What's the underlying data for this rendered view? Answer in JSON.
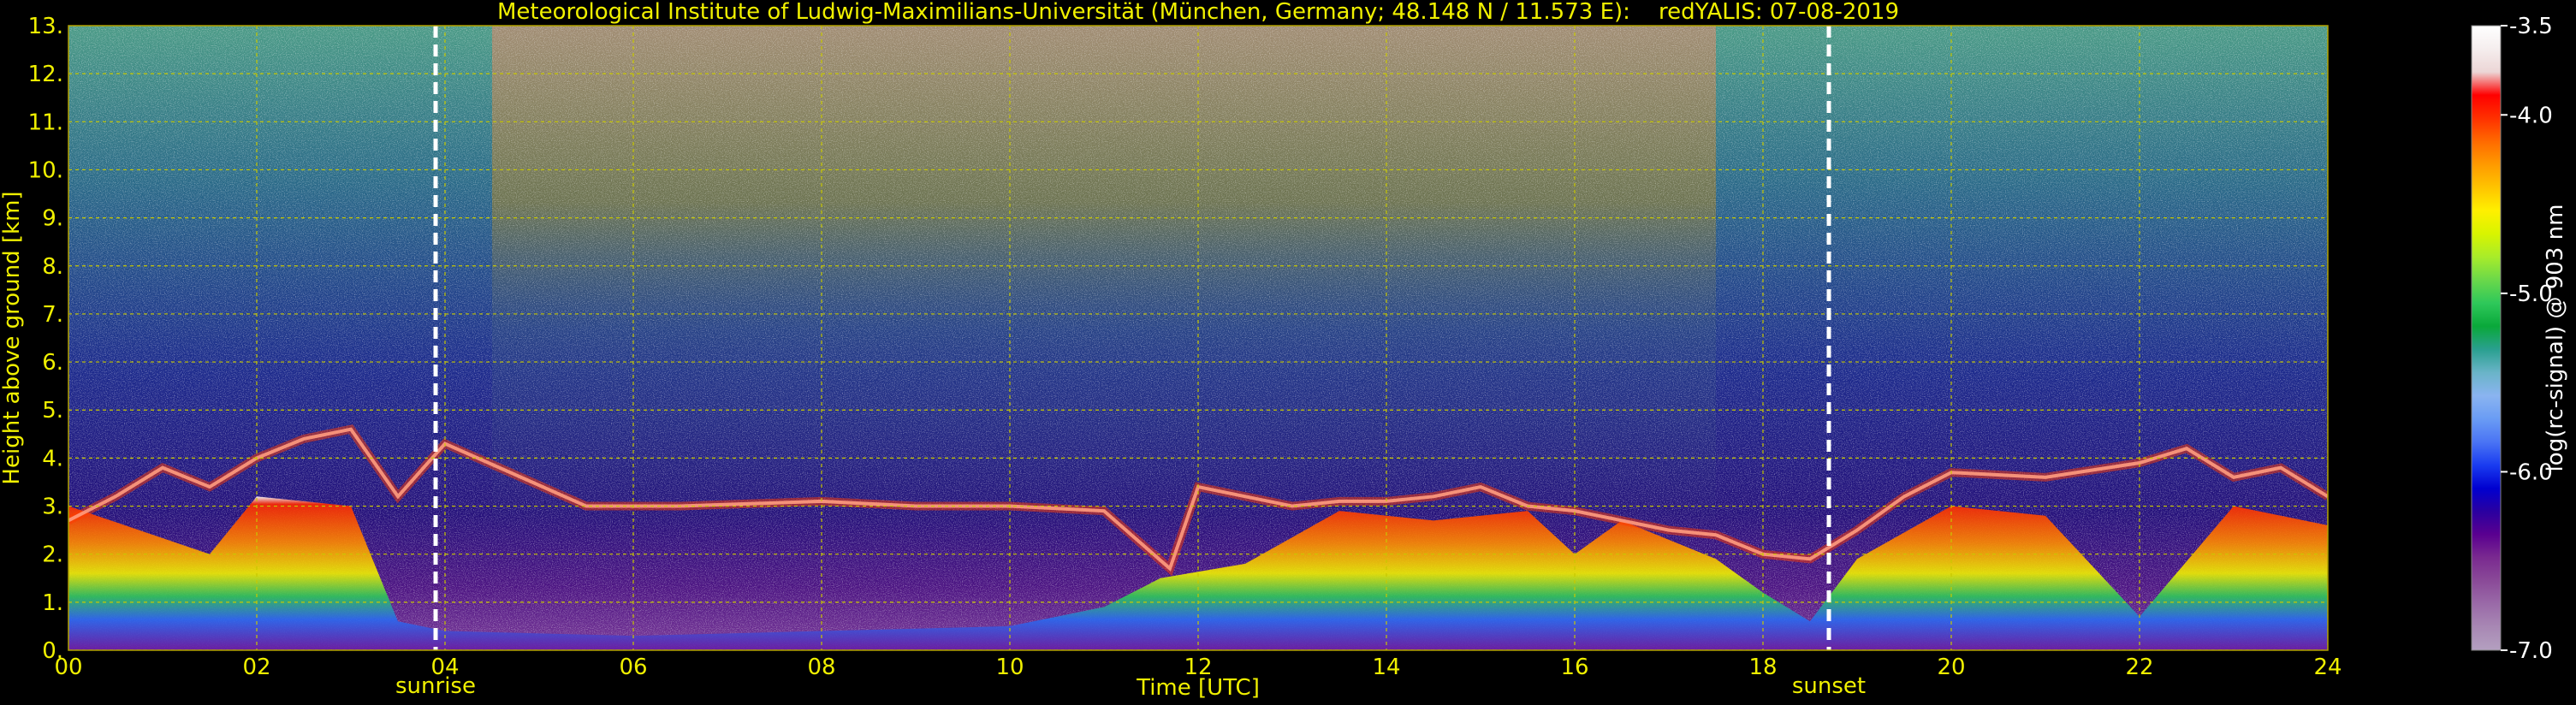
{
  "chart_data": {
    "type": "heatmap",
    "title": "Meteorological Institute of Ludwig-Maximilians-Universität (München, Germany; 48.148 N / 11.573 E):    redYALIS: 07-08-2019",
    "xlabel": "Time [UTC]",
    "ylabel": "Height above ground [km]",
    "xlim": [
      0,
      24
    ],
    "ylim": [
      0,
      13
    ],
    "x_ticks": [
      "00",
      "02",
      "04",
      "06",
      "08",
      "10",
      "12",
      "14",
      "16",
      "18",
      "20",
      "22",
      "24"
    ],
    "y_ticks": [
      "0.",
      "1.",
      "2.",
      "3.",
      "4.",
      "5.",
      "6.",
      "7.",
      "8.",
      "9.",
      "10.",
      "11.",
      "12.",
      "13."
    ],
    "grid": true,
    "colorbar": {
      "label": "log(rc-signal) @ 903 nm",
      "range": [
        -7.0,
        -3.5
      ],
      "ticks": [
        -3.5,
        -4.0,
        -5.0,
        -6.0,
        -7.0
      ],
      "tick_labels": [
        "-3.5",
        "-4.0",
        "-5.0",
        "-6.0",
        "-7.0"
      ],
      "colors": [
        "#ffffff",
        "#f5eeee",
        "#ecd6d6",
        "#ff0000",
        "#ff3000",
        "#ff6a00",
        "#ff9a00",
        "#ffc400",
        "#fff000",
        "#d8f400",
        "#a8ec2a",
        "#6ad84a",
        "#2ec85a",
        "#0aa83a",
        "#2aa090",
        "#6ab4c8",
        "#8ab4f0",
        "#6a9cf4",
        "#4a74f4",
        "#1a3cf0",
        "#0000d0",
        "#2a00a0",
        "#5a0090",
        "#7a2a90",
        "#8a4a98",
        "#9a6aa8",
        "#a888b4",
        "#b4a0c0"
      ]
    },
    "events": [
      {
        "time": 3.9,
        "label": "sunrise"
      },
      {
        "time": 18.7,
        "label": "sunset"
      }
    ],
    "series": [
      {
        "name": "cloud_layer",
        "x": [
          0.0,
          0.5,
          1.0,
          1.5,
          2.0,
          2.5,
          3.0,
          3.5,
          4.0,
          5.5,
          6.5,
          8.0,
          9.0,
          10.0,
          11.0,
          11.7,
          12.0,
          13.0,
          13.5,
          14.0,
          14.5,
          15.0,
          15.5,
          16.0,
          17.0,
          17.5,
          18.0,
          18.5,
          19.0,
          19.5,
          20.0,
          21.0,
          22.0,
          22.5,
          23.0,
          23.5,
          24.0
        ],
        "top": [
          2.7,
          3.2,
          3.8,
          3.4,
          4.0,
          4.4,
          4.6,
          3.2,
          4.3,
          3.0,
          3.0,
          3.1,
          3.0,
          3.0,
          2.9,
          1.7,
          3.4,
          3.0,
          3.1,
          3.1,
          3.2,
          3.4,
          3.0,
          2.9,
          2.5,
          2.4,
          2.0,
          1.9,
          2.5,
          3.2,
          3.7,
          3.6,
          3.9,
          4.2,
          3.6,
          3.8,
          3.2
        ]
      },
      {
        "name": "boundary_layer",
        "x": [
          0.0,
          1.5,
          2.0,
          3.0,
          3.5,
          4.0,
          6.0,
          8.0,
          10.0,
          11.0,
          11.6,
          12.5,
          13.5,
          14.5,
          15.5,
          16.0,
          16.5,
          17.0,
          17.5,
          18.0,
          18.5,
          19.0,
          20.0,
          21.0,
          22.0,
          23.0,
          24.0
        ],
        "top": [
          3.0,
          2.0,
          3.2,
          3.0,
          0.6,
          0.4,
          0.3,
          0.4,
          0.5,
          0.9,
          1.5,
          1.8,
          2.9,
          2.7,
          2.9,
          2.0,
          2.7,
          2.3,
          1.9,
          1.2,
          0.6,
          1.9,
          3.0,
          2.8,
          0.7,
          3.0,
          2.6
        ]
      }
    ]
  }
}
